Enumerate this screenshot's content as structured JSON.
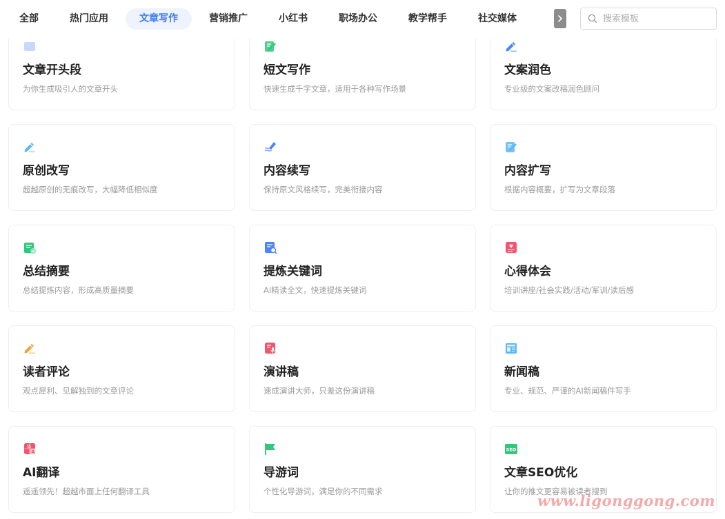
{
  "tabs": [
    {
      "label": "全部",
      "active": false
    },
    {
      "label": "热门应用",
      "active": false
    },
    {
      "label": "文章写作",
      "active": true
    },
    {
      "label": "营销推广",
      "active": false
    },
    {
      "label": "小红书",
      "active": false
    },
    {
      "label": "职场办公",
      "active": false
    },
    {
      "label": "教学帮手",
      "active": false
    },
    {
      "label": "社交媒体",
      "active": false
    }
  ],
  "search": {
    "placeholder": "搜索模板"
  },
  "cards": [
    {
      "title": "文章开头段",
      "desc": "为你生成吸引人的文章开头",
      "icon": "document-icon",
      "color": "#c9d7fb"
    },
    {
      "title": "短文写作",
      "desc": "快速生成千字文章，适用于各种写作场景",
      "icon": "edit-icon",
      "color": "#34c77b"
    },
    {
      "title": "文案润色",
      "desc": "专业级的文案改稿润色顾问",
      "icon": "pencil-icon",
      "color": "#4a86f7"
    },
    {
      "title": "原创改写",
      "desc": "超越原创的无痕改写，大幅降低相似度",
      "icon": "pencil-icon",
      "color": "#5cb8f5"
    },
    {
      "title": "内容续写",
      "desc": "保持原文风格续写，完美衔接内容",
      "icon": "pen-icon",
      "color": "#4a86f7"
    },
    {
      "title": "内容扩写",
      "desc": "根据内容概要，扩写为文章段落",
      "icon": "edit-icon",
      "color": "#5cb8f5"
    },
    {
      "title": "总结摘要",
      "desc": "总结提炼内容，形成高质量摘要",
      "icon": "checklist-icon",
      "color": "#34c77b"
    },
    {
      "title": "提炼关键词",
      "desc": "AI精读全文，快速提炼关键词",
      "icon": "search-doc-icon",
      "color": "#4a86f7"
    },
    {
      "title": "心得体会",
      "desc": "培训讲座/社会实践/活动/军训/读后感",
      "icon": "heart-icon",
      "color": "#f1566c"
    },
    {
      "title": "读者评论",
      "desc": "观点犀利、见解独到的文章评论",
      "icon": "pencil-icon",
      "color": "#f5a23a"
    },
    {
      "title": "演讲稿",
      "desc": "速成演讲大师，只差这份演讲稿",
      "icon": "microphone-icon",
      "color": "#f1566c"
    },
    {
      "title": "新闻稿",
      "desc": "专业、规范、严谨的AI新闻稿件写手",
      "icon": "newspaper-icon",
      "color": "#5cb8f5"
    },
    {
      "title": "AI翻译",
      "desc": "遥遥领先！超越市面上任何翻译工具",
      "icon": "translate-icon",
      "color": "#f1566c"
    },
    {
      "title": "导游词",
      "desc": "个性化导游词，满足你的不同需求",
      "icon": "flag-icon",
      "color": "#34c77b"
    },
    {
      "title": "文章SEO优化",
      "desc": "让你的推文更容易被读者搜到",
      "icon": "seo-icon",
      "color": "#34c77b"
    }
  ],
  "seo_badge": "SEO",
  "translate_badge": "译",
  "watermark": "www.ligonggong.com"
}
